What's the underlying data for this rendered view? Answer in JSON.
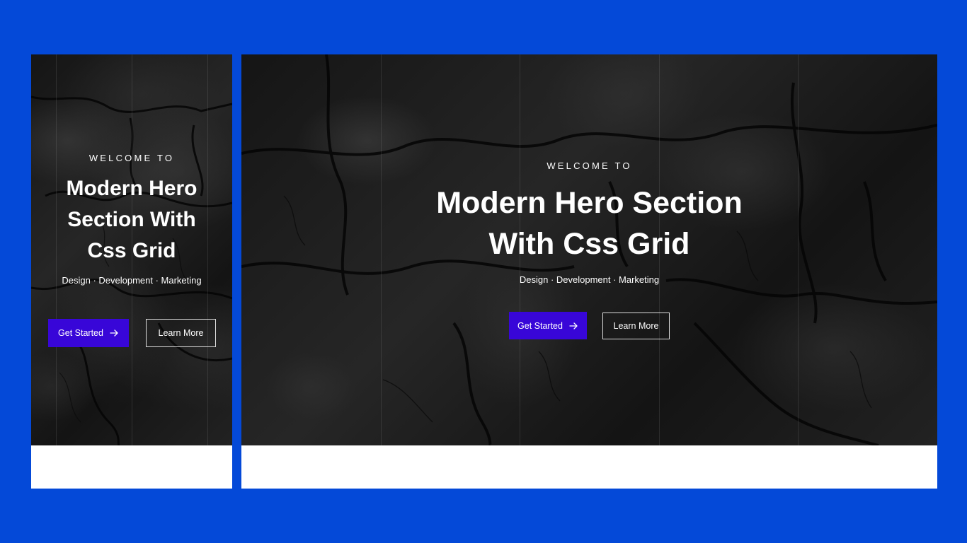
{
  "colors": {
    "page_background": "#0449d8",
    "primary_button": "#3806d8",
    "hero_text": "#ffffff",
    "frame_background": "#ffffff"
  },
  "previews": {
    "mobile": {
      "eyebrow": "WELCOME TO",
      "title": "Modern Hero Section With Css Grid",
      "subtitle": "Design · Development · Marketing",
      "primary_button": "Get Started",
      "primary_button_icon": "arrow-right-icon",
      "secondary_button": "Learn More"
    },
    "desktop": {
      "eyebrow": "WELCOME TO",
      "title": "Modern Hero Section With Css Grid",
      "subtitle": "Design · Development · Marketing",
      "primary_button": "Get Started",
      "primary_button_icon": "arrow-right-icon",
      "secondary_button": "Learn More"
    }
  }
}
